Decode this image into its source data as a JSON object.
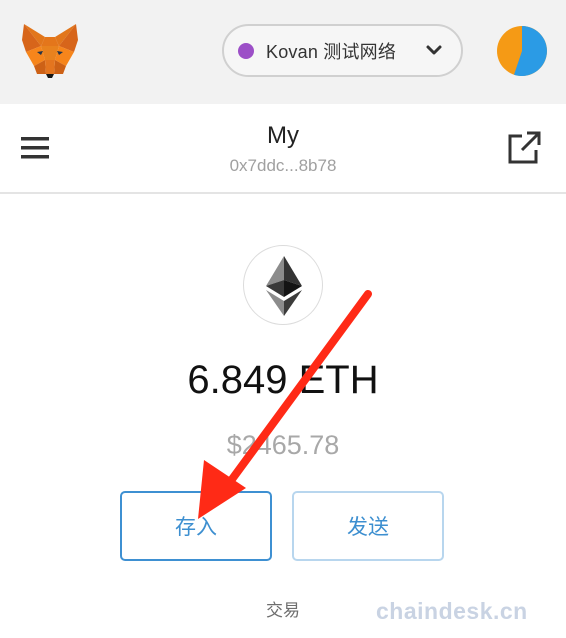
{
  "network": {
    "label": "Kovan 测试网络",
    "dot_color": "#9c4fc7"
  },
  "account": {
    "name": "My",
    "address": "0x7ddc...8b78"
  },
  "balance": {
    "amount": "6.849 ETH",
    "fiat": "$2465.78"
  },
  "actions": {
    "deposit_label": "存入",
    "send_label": "发送"
  },
  "tabs": {
    "transactions_label": "交易"
  },
  "watermark": "chaindesk.cn",
  "icons": {
    "logo": "metamask-fox-icon",
    "menu": "hamburger-menu-icon",
    "export": "external-link-icon",
    "token": "ethereum-icon",
    "network_dropdown": "chevron-down-icon",
    "avatar": "account-avatar-icon"
  },
  "colors": {
    "accent": "#3e90d2",
    "annotation": "#ff2a16"
  }
}
